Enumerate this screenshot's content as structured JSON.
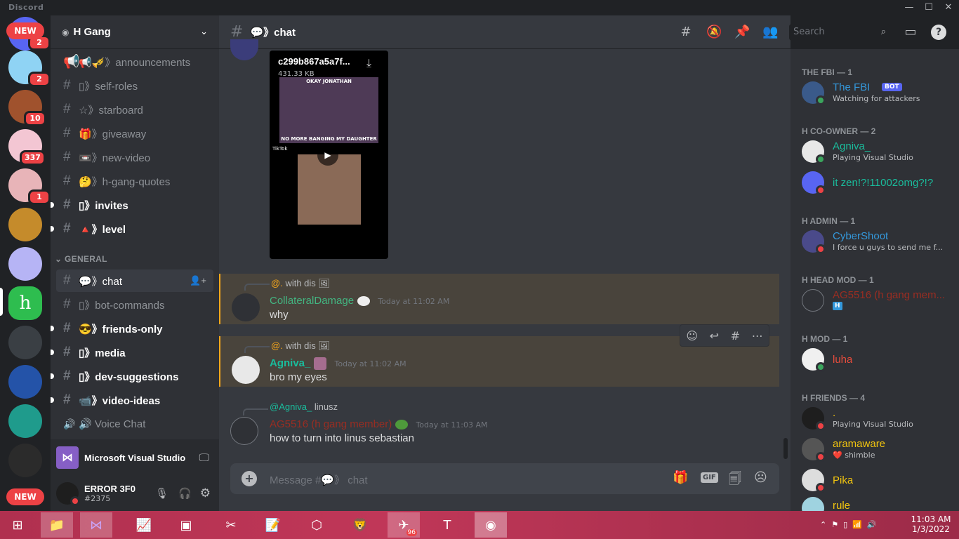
{
  "window": {
    "title": "Discord",
    "controls": [
      "—",
      "☐",
      "✕"
    ]
  },
  "rail": {
    "new_label_top": "NEW",
    "new_label_bottom": "NEW",
    "servers": [
      {
        "badge": "2",
        "color": "#5865f2"
      },
      {
        "badge": "2",
        "color": "#8fd3f4"
      },
      {
        "badge": "10",
        "color": "#a0522d"
      },
      {
        "badge": "337",
        "color": "#f3c6d3"
      },
      {
        "badge": "1",
        "color": "#e8b4b8"
      },
      {
        "badge": "",
        "color": "#c58b2b"
      },
      {
        "badge": "",
        "color": "#b6b4f5"
      },
      {
        "badge": "",
        "color": "#2ebd4f"
      },
      {
        "badge": "",
        "color": "#3a3f44"
      },
      {
        "badge": "",
        "color": "#2453a8"
      },
      {
        "badge": "",
        "color": "#1f9b8c"
      },
      {
        "badge": "",
        "color": "#2b2b2b"
      }
    ]
  },
  "guild": {
    "name": "H Gang"
  },
  "channels": [
    {
      "name": "📢🎺》announcements",
      "type": "announce",
      "unread": false
    },
    {
      "name": "▯》self-roles",
      "type": "text",
      "unread": false
    },
    {
      "name": "☆》starboard",
      "type": "text",
      "unread": false
    },
    {
      "name": "🎁》giveaway",
      "type": "text",
      "unread": false
    },
    {
      "name": "📼》new-video",
      "type": "text",
      "unread": false
    },
    {
      "name": "🤔》h-gang-quotes",
      "type": "text",
      "unread": false
    },
    {
      "name": "▯》invites",
      "type": "text",
      "unread": true
    },
    {
      "name": "🔺》level",
      "type": "text",
      "unread": true
    }
  ],
  "category": "GENERAL",
  "general_channels": [
    {
      "name": "💬》chat",
      "active": true,
      "unread": false
    },
    {
      "name": "▯》bot-commands",
      "active": false,
      "unread": false
    },
    {
      "name": "😎》friends-only",
      "active": false,
      "unread": true
    },
    {
      "name": "▯》media",
      "active": false,
      "unread": true
    },
    {
      "name": "▯》dev-suggestions",
      "active": false,
      "unread": true
    },
    {
      "name": "📹》video-ideas",
      "active": false,
      "unread": true
    },
    {
      "name": "🔊 Voice Chat",
      "active": false,
      "unread": false,
      "voice": true
    }
  ],
  "activity": {
    "app": "Microsoft Visual Studio"
  },
  "user": {
    "name": "ERROR 3F0",
    "tag": "#2375"
  },
  "chat": {
    "channel_title": "💬》chat",
    "search_placeholder": "Search",
    "attachment": {
      "filename": "c299b867a5a7f...",
      "size": "431.33 KB",
      "caption_top": "OKAY JONATHAN",
      "caption_bottom": "NO MORE BANGING MY DAUGHTER",
      "watermark": "TikTok"
    },
    "messages": [
      {
        "reply_author": "@.",
        "reply_text": "with dis",
        "author": "CollateralDamage",
        "author_color": "#43b581",
        "time": "Today at 11:02 AM",
        "text": "why",
        "highlight": true
      },
      {
        "reply_author": "@.",
        "reply_text": "with dis",
        "author": "Agniva_",
        "author_color": "#1abc9c",
        "time": "Today at 11:02 AM",
        "text": "bro my eyes",
        "highlight": true
      },
      {
        "reply_author": "@Agniva_",
        "reply_text": "linusz",
        "author": "AG5516 (h gang member)",
        "author_color": "#992d22",
        "time": "Today at 11:03 AM",
        "text": "how to turn into linus sebastian",
        "highlight": false
      }
    ],
    "composer_placeholder": "Message #💬》 chat",
    "gif_label": "GIF"
  },
  "members": {
    "groups": [
      {
        "title": "THE FBI — 1"
      },
      {
        "title": "H CO-OWNER — 2"
      },
      {
        "title": "H ADMIN — 1"
      },
      {
        "title": "H HEAD MOD — 1"
      },
      {
        "title": "H MOD — 1"
      },
      {
        "title": "H FRIENDS — 4"
      }
    ],
    "list": [
      {
        "name": "The FBI",
        "color": "#3498db",
        "activity": "Watching for attackers",
        "bot": "BOT",
        "status": "#3ba55d"
      },
      {
        "name": "Agniva_",
        "color": "#1abc9c",
        "activity": "Playing Visual Studio",
        "status": "#3ba55d"
      },
      {
        "name": "it zen!?!11002omg?!?",
        "color": "#1abc9c",
        "activity": "",
        "status": "#ed4245"
      },
      {
        "name": "CyberShoot",
        "color": "#3498db",
        "activity": "I force u guys to send me f...",
        "status": "#ed4245"
      },
      {
        "name": "AG5516 (h gang mem...",
        "color": "#992d22",
        "activity": "H",
        "status": ""
      },
      {
        "name": "luha",
        "color": "#e74c3c",
        "activity": "",
        "status": "#3ba55d"
      },
      {
        "name": ".",
        "color": "#f1c40f",
        "activity": "Playing Visual Studio",
        "status": "#ed4245"
      },
      {
        "name": "aramaware",
        "color": "#f1c40f",
        "activity": "❤️ shimble",
        "status": "#ed4245"
      },
      {
        "name": "Pika",
        "color": "#f1c40f",
        "activity": "",
        "status": "#ed4245"
      },
      {
        "name": "rule",
        "color": "#f1c40f",
        "activity": "",
        "status": ""
      }
    ]
  },
  "taskbar": {
    "time": "11:03 AM",
    "date": "1/3/2022",
    "telegram_badge": "96"
  }
}
